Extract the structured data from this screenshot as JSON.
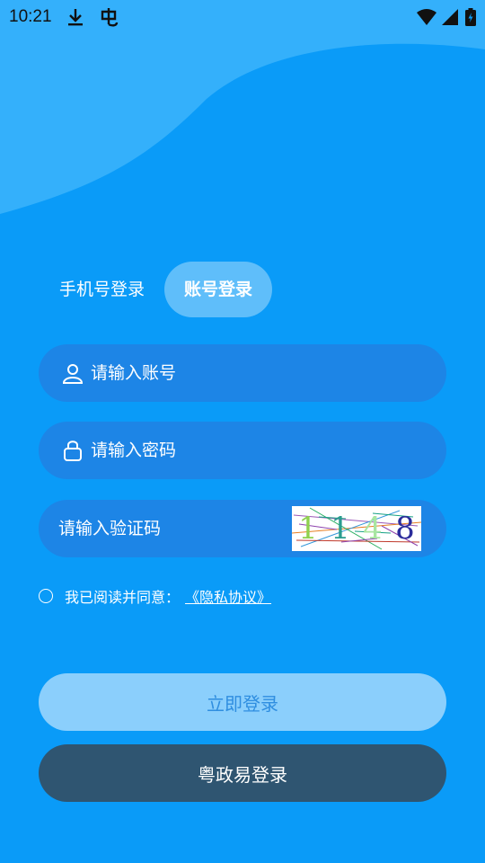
{
  "status_bar": {
    "time": "10:21",
    "icons": [
      "download-icon",
      "bug-icon",
      "wifi-icon",
      "signal-icon",
      "battery-icon"
    ]
  },
  "tabs": {
    "phone_login": "手机号登录",
    "account_login": "账号登录",
    "active": "account_login"
  },
  "form": {
    "account_placeholder": "请输入账号",
    "password_placeholder": "请输入密码",
    "captcha_placeholder": "请输入验证码",
    "captcha_digits": [
      "1",
      "1",
      "4",
      "8"
    ]
  },
  "agreement": {
    "text": "我已阅读并同意：",
    "link": "《隐私协议》",
    "checked": false
  },
  "buttons": {
    "login": "立即登录",
    "yuezhengyi_login": "粤政易登录"
  },
  "colors": {
    "background": "#0a9bf8",
    "wave": "#34b0fb",
    "field": "#1d85e6",
    "login_button": "#8bcffc",
    "yzy_button": "#2f5571"
  }
}
